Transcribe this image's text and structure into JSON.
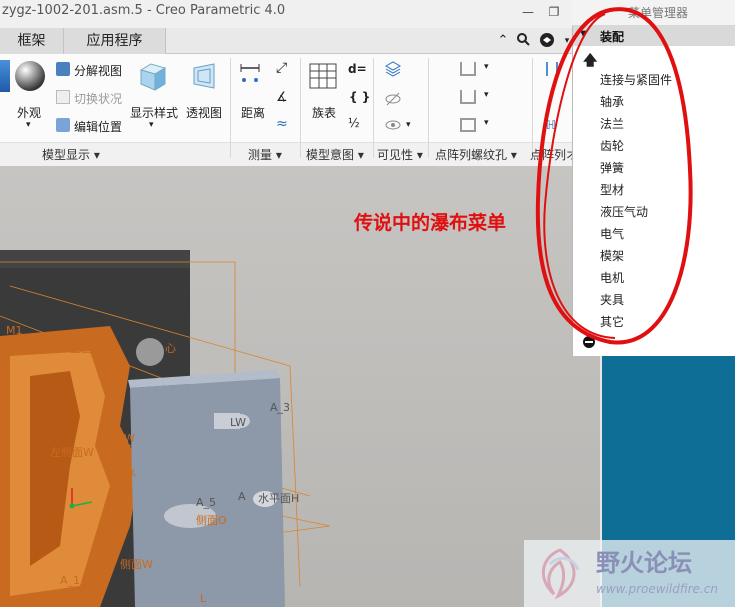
{
  "window": {
    "title": "zygz-1002-201.asm.5 - Creo Parametric 4.0"
  },
  "tabs": [
    "框架",
    "应用程序"
  ],
  "quick_icons": [
    "chevron-up-icon",
    "search-icon",
    "help-icon",
    "dropdown-icon"
  ],
  "ribbon": {
    "buttons": {
      "exploded_view": "分解视图",
      "toggle_state": "切换状况",
      "edit_position": "编辑位置",
      "appearance": "外观",
      "display_style": "显示样式",
      "perspective": "透视图",
      "distance": "距离",
      "family_table": "族表",
      "d_equals": "d=",
      "braces": "{ }"
    },
    "groups": {
      "model_display": "模型显示",
      "measure": "测量",
      "model_intent": "模型意图",
      "visibility": "可见性",
      "pattern_thread": "点阵列螺纹孔",
      "pattern_cut": "点阵列オ"
    }
  },
  "panel": {
    "title": "菜单管理器",
    "menu_header": "装配",
    "items": [
      "连接与紧固件",
      "轴承",
      "法兰",
      "齿轮",
      "弹簧",
      "型材",
      "液压气动",
      "电气",
      "模架",
      "电机",
      "夹具",
      "其它"
    ]
  },
  "annotation": {
    "text": "传说中的瀑布菜单",
    "color": "#e01010"
  },
  "model_labels": [
    "M1",
    "止面W",
    "心",
    "A_3",
    "LW",
    "侧面W",
    "左侧面W",
    "水平面H",
    "水",
    "侧面O",
    "A_5",
    "A",
    "侧面W",
    "A_1",
    "L"
  ],
  "watermark": {
    "cn": "野火论坛",
    "url": "www.proewildfire.cn"
  },
  "colors": {
    "teal": "#0f6e95",
    "annotation_red": "#e01010"
  }
}
